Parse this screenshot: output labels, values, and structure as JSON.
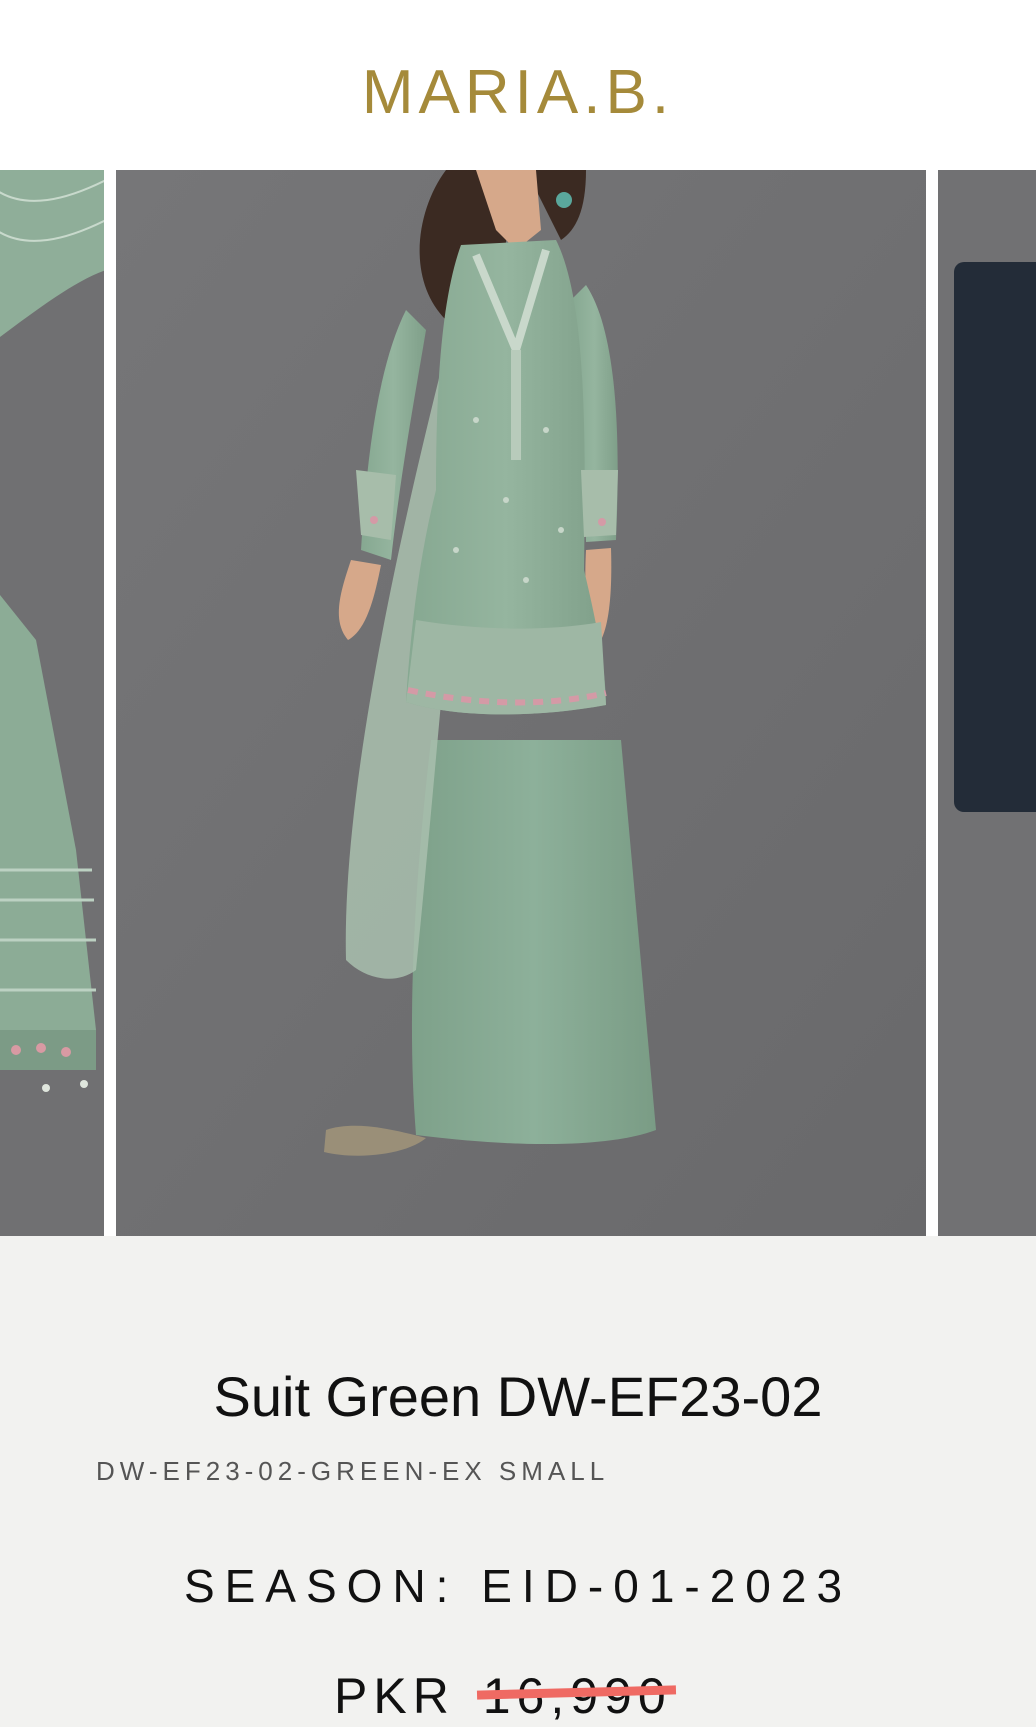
{
  "brand": {
    "logo_text": "MARIA.B."
  },
  "carousel": {
    "slides": [
      {
        "name": "previous-product-image",
        "desc": "embroidered green suit detail"
      },
      {
        "name": "main-product-image",
        "desc": "model wearing green embroidered suit with dupatta"
      },
      {
        "name": "next-product-image",
        "desc": "next product image"
      }
    ]
  },
  "product": {
    "title": "Suit Green DW-EF23-02",
    "sku": "DW-EF23-02-GREEN-EX SMALL",
    "season_label": "SEASON:",
    "season_value": "EID-01-2023",
    "currency": "PKR",
    "price_original": "16,990"
  },
  "colors": {
    "brand_gold": "#a58a3a",
    "backdrop_gray": "#6f6f71",
    "suit_green": "#8fb09a",
    "strike_red": "#ef6a63",
    "panel_navy": "#232c38"
  }
}
